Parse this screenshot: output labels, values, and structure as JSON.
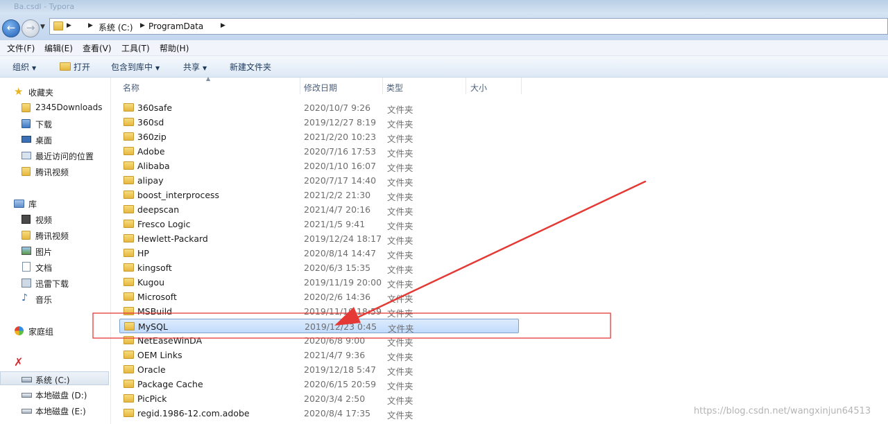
{
  "window": {
    "ghost_title": "Ba.csdl - Typora"
  },
  "address_bar": {
    "crumbs": [
      "系统 (C:)",
      "ProgramData"
    ]
  },
  "menu": [
    "文件(F)",
    "编辑(E)",
    "查看(V)",
    "工具(T)",
    "帮助(H)"
  ],
  "toolbar": {
    "organize": "组织",
    "open": "打开",
    "include_in_library": "包含到库中",
    "share": "共享",
    "new_folder": "新建文件夹"
  },
  "nav": {
    "favorites": {
      "label": "收藏夹",
      "items": [
        "2345Downloads",
        "下载",
        "桌面",
        "最近访问的位置",
        "腾讯视频"
      ]
    },
    "libraries": {
      "label": "库",
      "items": [
        "视频",
        "腾讯视频",
        "图片",
        "文档",
        "迅雷下载",
        "音乐"
      ]
    },
    "homegroup": "家庭组",
    "computer": {
      "drives": [
        "系统 (C:)",
        "本地磁盘 (D:)",
        "本地磁盘 (E:)"
      ]
    }
  },
  "columns": {
    "name": "名称",
    "date": "修改日期",
    "type": "类型",
    "size": "大小"
  },
  "files": [
    {
      "name": "360safe",
      "date": "2020/10/7 9:26",
      "type": "文件夹"
    },
    {
      "name": "360sd",
      "date": "2019/12/27 8:19",
      "type": "文件夹"
    },
    {
      "name": "360zip",
      "date": "2021/2/20 10:23",
      "type": "文件夹"
    },
    {
      "name": "Adobe",
      "date": "2020/7/16 17:53",
      "type": "文件夹"
    },
    {
      "name": "Alibaba",
      "date": "2020/1/10 16:07",
      "type": "文件夹"
    },
    {
      "name": "alipay",
      "date": "2020/7/17 14:40",
      "type": "文件夹"
    },
    {
      "name": "boost_interprocess",
      "date": "2021/2/2 21:30",
      "type": "文件夹"
    },
    {
      "name": "deepscan",
      "date": "2021/4/7 20:16",
      "type": "文件夹"
    },
    {
      "name": "Fresco Logic",
      "date": "2021/1/5 9:41",
      "type": "文件夹"
    },
    {
      "name": "Hewlett-Packard",
      "date": "2019/12/24 18:17",
      "type": "文件夹"
    },
    {
      "name": "HP",
      "date": "2020/8/14 14:47",
      "type": "文件夹"
    },
    {
      "name": "kingsoft",
      "date": "2020/6/3 15:35",
      "type": "文件夹"
    },
    {
      "name": "Kugou",
      "date": "2019/11/19 20:00",
      "type": "文件夹"
    },
    {
      "name": "Microsoft",
      "date": "2020/2/6 14:36",
      "type": "文件夹"
    },
    {
      "name": "MSBuild",
      "date": "2019/11/19 18:59",
      "type": "文件夹"
    },
    {
      "name": "MySQL",
      "date": "2019/12/23 0:45",
      "type": "文件夹"
    },
    {
      "name": "NetEaseWinDA",
      "date": "2020/6/8 9:00",
      "type": "文件夹"
    },
    {
      "name": "OEM Links",
      "date": "2021/4/7 9:36",
      "type": "文件夹"
    },
    {
      "name": "Oracle",
      "date": "2019/12/18 5:47",
      "type": "文件夹"
    },
    {
      "name": "Package Cache",
      "date": "2020/6/15 20:59",
      "type": "文件夹"
    },
    {
      "name": "PicPick",
      "date": "2020/3/4 2:50",
      "type": "文件夹"
    },
    {
      "name": "regid.1986-12.com.adobe",
      "date": "2020/8/4 17:35",
      "type": "文件夹"
    }
  ],
  "selected_file": "MySQL",
  "watermark": "https://blog.csdn.net/wangxinjun64513",
  "colors": {
    "annotation_red": "#e53935",
    "selection_border": "#7da2ce"
  }
}
